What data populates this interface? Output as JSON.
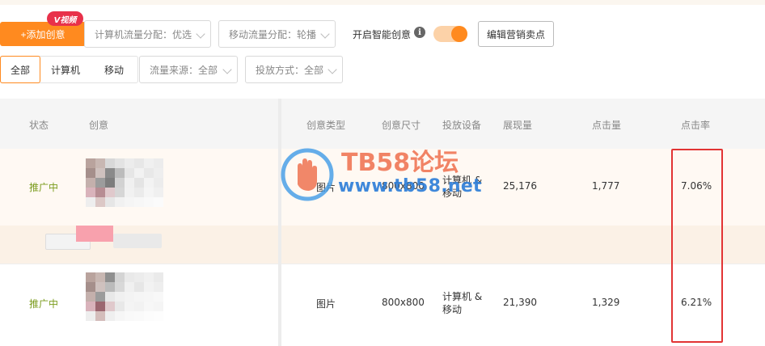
{
  "toolbar": {
    "add_button": "+添加创意",
    "video_badge": "V视频",
    "pc_traffic": "计算机流量分配：优选",
    "mobile_traffic": "移动流量分配：轮播",
    "smart_label": "开启智能创意",
    "smart_toggle_on": true,
    "edit_button": "编辑营销卖点"
  },
  "filters": {
    "device_tabs": [
      "全部",
      "计算机",
      "移动"
    ],
    "active_tab": "全部",
    "traffic_source": "流量来源：全部",
    "delivery_method": "投放方式：全部"
  },
  "table": {
    "headers": {
      "status": "状态",
      "creative": "创意",
      "type": "创意类型",
      "size": "创意尺寸",
      "device": "投放设备",
      "impressions": "展现量",
      "clicks": "点击量",
      "ctr": "点击率"
    },
    "rows": [
      {
        "status": "推广中",
        "type": "图片",
        "size": "800x800",
        "device": "计算机 & 移动",
        "impressions": "25,176",
        "clicks": "1,777",
        "ctr": "7.06%"
      },
      {
        "status": "推广中",
        "type": "图片",
        "size": "800x800",
        "device": "计算机 & 移动",
        "impressions": "21,390",
        "clicks": "1,329",
        "ctr": "6.21%"
      }
    ]
  },
  "watermark": {
    "title": "TB58论坛",
    "url": "www.tb58.net"
  },
  "colors": {
    "accent": "#ff8a1f",
    "status_active": "#7a9b1c",
    "highlight_box": "#e23434",
    "badge": "#e8314a"
  }
}
